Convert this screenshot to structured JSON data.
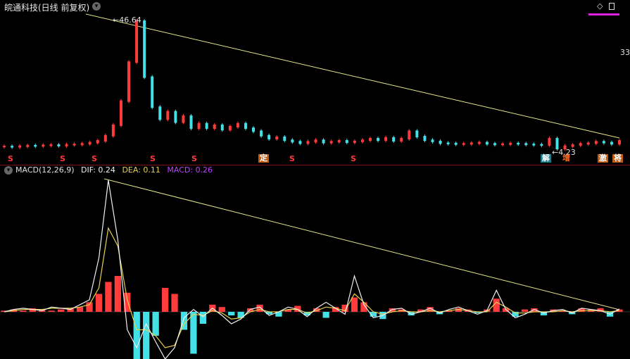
{
  "header": {
    "title": "皖通科技(日线 前复权)",
    "toggle_icon": "chevron-down-icon",
    "right_icons": [
      "diamond-icon",
      "window-icon"
    ],
    "price_axis_label": "33"
  },
  "price_chart": {
    "peak_label": "46.64",
    "low_label": "4.23",
    "signals": [
      "S",
      "S",
      "S",
      "S",
      "S",
      "定",
      "S",
      "S",
      "解",
      "增",
      "激",
      "将"
    ],
    "colors": {
      "up": "#ff3b3b",
      "down": "#44e0e8",
      "trendline": "#e6e68a",
      "box_orange": "#c05a10",
      "box_cyan": "#1a7a8a"
    }
  },
  "macd_panel": {
    "name": "MACD(12,26,9)",
    "dif_label": "DIF: 0.24",
    "dea_label": "DEA: 0.11",
    "macd_label": "MACD: 0.26",
    "colors": {
      "dif": "#f0f0f0",
      "dea": "#e8d050",
      "macd": "#c040ff"
    }
  },
  "chart_data": [
    {
      "type": "line",
      "title": "皖通科技(日线 前复权)",
      "series": [
        {
          "values": [
            4.9,
            4.8,
            5.0,
            5.2,
            5.1,
            5.3,
            5.4,
            5.2,
            5.5,
            5.6,
            5.8,
            6.2,
            6.8,
            8.5,
            12.0,
            20.0,
            33.0,
            46.64,
            28.0,
            18.0,
            14.0,
            16.5,
            13.0,
            15.0,
            11.0,
            12.5,
            11.0,
            12.0,
            10.5,
            11.5,
            12.5,
            11.0,
            10.0,
            8.5,
            7.5,
            8.0,
            7.0,
            6.5,
            6.0,
            6.5,
            7.0,
            6.2,
            6.5,
            6.8,
            6.3,
            6.6,
            7.0,
            7.5,
            7.0,
            7.8,
            6.8,
            7.5,
            10.0,
            8.2,
            7.0,
            6.6,
            6.0,
            5.9,
            5.7,
            5.8,
            6.0,
            6.2,
            5.8,
            5.6,
            5.7,
            5.9,
            5.8,
            5.6,
            5.5,
            5.4,
            7.5,
            4.23,
            5.0,
            5.4,
            5.8,
            6.0,
            6.5,
            6.2,
            5.8,
            6.8
          ]
        }
      ],
      "annotations": [
        "46.64",
        "4.23"
      ]
    },
    {
      "type": "bar",
      "title": "MACD(12,26,9)",
      "series": [
        {
          "name": "MACD",
          "values": [
            0.1,
            0.2,
            0.1,
            0.3,
            0.2,
            0.1,
            0.2,
            0.3,
            0.4,
            0.8,
            1.5,
            2.5,
            3.0,
            1.6,
            -4.5,
            -5.0,
            -2.0,
            2.0,
            1.5,
            -1.5,
            -3.5,
            -1.0,
            0.6,
            0.4,
            -0.3,
            -0.5,
            0.3,
            0.6,
            -0.2,
            -0.4,
            0.2,
            0.5,
            -0.3,
            0.3,
            -0.5,
            0.4,
            0.6,
            1.2,
            0.8,
            -0.4,
            -0.6,
            0.3,
            0.2,
            -0.3,
            0.2,
            0.4,
            -0.2,
            0.1,
            0.3,
            0.2,
            -0.1,
            0.2,
            1.1,
            0.3,
            -0.4,
            0.2,
            0.3,
            -0.3,
            0.2,
            0.1,
            -0.2,
            0.3,
            0.2,
            0.3,
            -0.4,
            0.2
          ]
        },
        {
          "name": "DIF",
          "values": [
            0.0,
            0.2,
            0.3,
            0.2,
            0.1,
            0.4,
            0.3,
            0.2,
            0.6,
            1.0,
            4.5,
            11.0,
            6.0,
            -1.5,
            -3.0,
            -1.0,
            -2.5,
            -4.0,
            -3.0,
            -0.5,
            0.2,
            -0.4,
            0.3,
            -0.3,
            -1.0,
            -0.6,
            0.2,
            0.4,
            -0.3,
            0.0,
            0.4,
            0.2,
            -0.4,
            0.3,
            0.8,
            0.3,
            -0.2,
            3.0,
            0.6,
            -0.5,
            -0.3,
            0.2,
            0.3,
            -0.2,
            0.0,
            0.3,
            -0.1,
            0.2,
            0.4,
            0.1,
            -0.2,
            0.1,
            1.8,
            0.2,
            -0.5,
            -0.2,
            0.2,
            -0.1,
            0.1,
            0.2,
            -0.1,
            0.3,
            0.2,
            0.1,
            -0.2,
            0.24
          ]
        },
        {
          "name": "DEA",
          "values": [
            0.0,
            0.1,
            0.2,
            0.2,
            0.2,
            0.3,
            0.3,
            0.3,
            0.4,
            0.6,
            2.0,
            7.0,
            5.5,
            1.0,
            -1.5,
            -1.5,
            -2.0,
            -3.0,
            -2.8,
            -1.0,
            -0.2,
            -0.3,
            0.1,
            -0.1,
            -0.6,
            -0.5,
            0.0,
            0.2,
            0.0,
            0.0,
            0.2,
            0.2,
            -0.1,
            0.1,
            0.4,
            0.3,
            0.1,
            1.5,
            0.8,
            0.0,
            -0.2,
            0.0,
            0.1,
            0.0,
            0.0,
            0.1,
            0.0,
            0.1,
            0.2,
            0.1,
            0.0,
            0.0,
            0.8,
            0.4,
            -0.1,
            -0.1,
            0.0,
            0.0,
            0.0,
            0.1,
            0.0,
            0.1,
            0.1,
            0.1,
            0.0,
            0.11
          ]
        }
      ]
    }
  ]
}
